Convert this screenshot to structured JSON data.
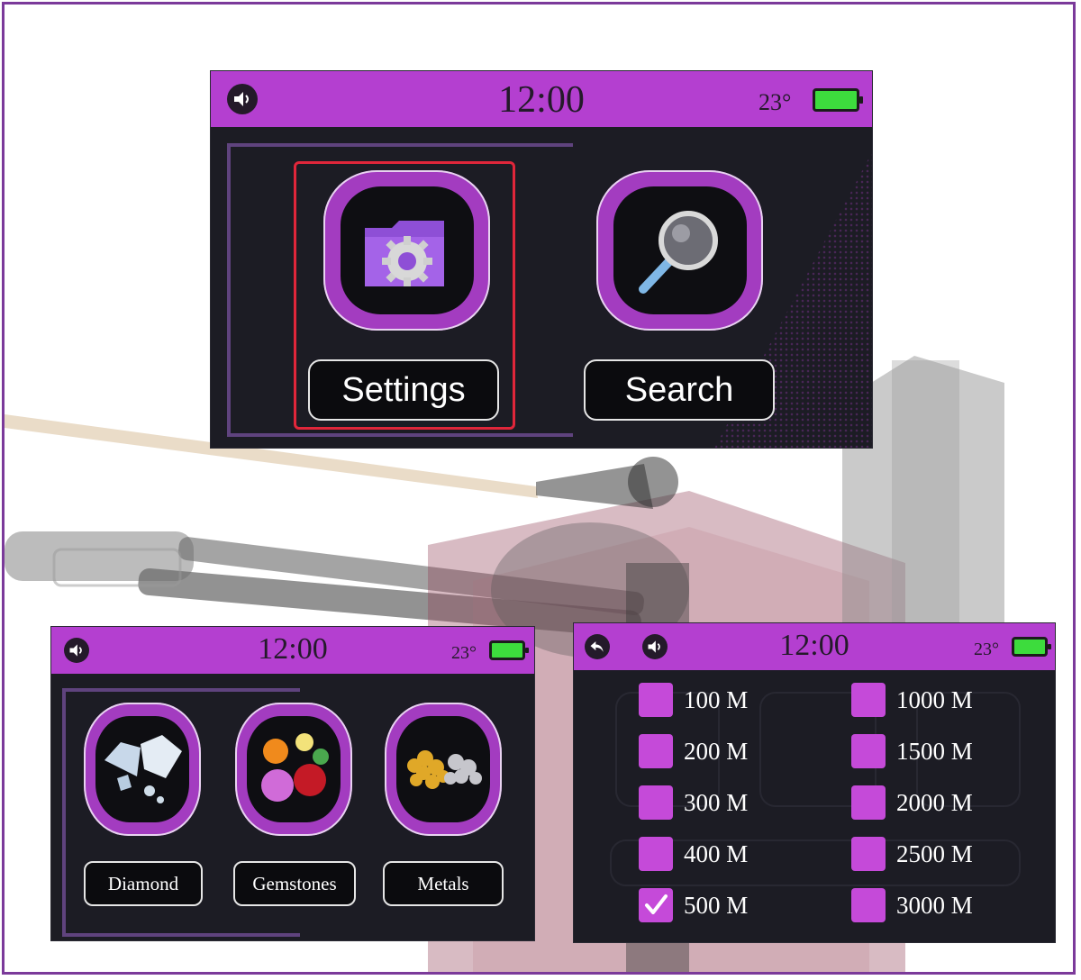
{
  "status": {
    "time": "12:00",
    "temperature": "23°"
  },
  "main_menu": {
    "items": [
      {
        "label": "Settings",
        "icon": "settings-folder-gear-icon",
        "selected": true
      },
      {
        "label": "Search",
        "icon": "magnifier-icon",
        "selected": false
      }
    ]
  },
  "target_menu": {
    "items": [
      {
        "label": "Diamond",
        "icon": "diamond-icon"
      },
      {
        "label": "Gemstones",
        "icon": "gemstones-icon"
      },
      {
        "label": "Metals",
        "icon": "metals-icon"
      }
    ]
  },
  "range_menu": {
    "left": [
      {
        "label": "100 M",
        "checked": false
      },
      {
        "label": "200 M",
        "checked": false
      },
      {
        "label": "300 M",
        "checked": false
      },
      {
        "label": "400 M",
        "checked": false
      },
      {
        "label": "500 M",
        "checked": true
      }
    ],
    "right": [
      {
        "label": "1000 M",
        "checked": false
      },
      {
        "label": "1500 M",
        "checked": false
      },
      {
        "label": "2000 M",
        "checked": false
      },
      {
        "label": "2500 M",
        "checked": false
      },
      {
        "label": "3000 M",
        "checked": false
      }
    ]
  },
  "colors": {
    "accent": "#b43fd0",
    "screen_bg": "#1c1c24",
    "battery": "#3ddc3d",
    "selection": "#e0263a"
  }
}
